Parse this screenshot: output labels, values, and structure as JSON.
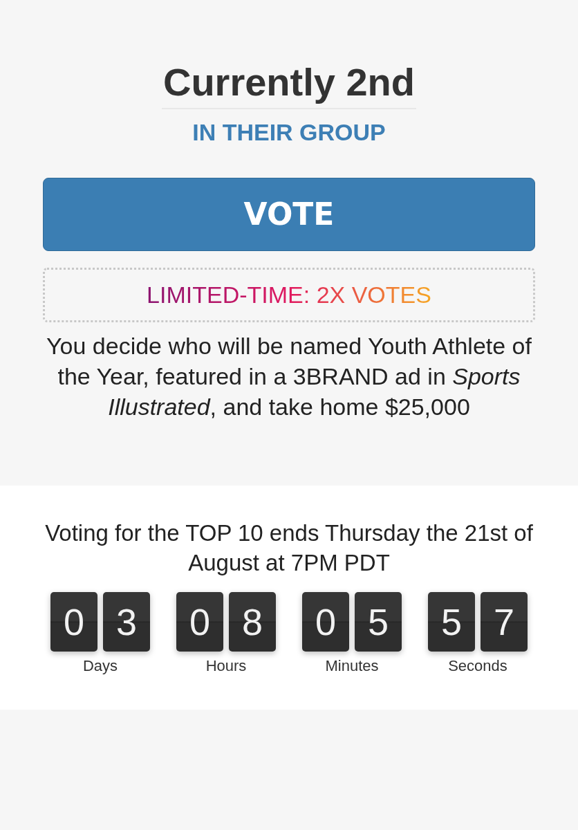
{
  "rank": {
    "title": "Currently 2nd",
    "subtitle": "IN THEIR GROUP"
  },
  "vote_button": {
    "label": "VOTE"
  },
  "promo": {
    "text": "LIMITED-TIME: 2X VOTES"
  },
  "description": "You decide who will be named Youth Athlete of the Year, featured in a 3BRAND ad in *Sports Illustrated*, and take home $25,000",
  "deadline": "Voting for the TOP 10 ends Thursday the 21st of August at 7PM PDT",
  "countdown": [
    {
      "digits": [
        "0",
        "3"
      ],
      "label": "Days"
    },
    {
      "digits": [
        "0",
        "8"
      ],
      "label": "Hours"
    },
    {
      "digits": [
        "0",
        "5"
      ],
      "label": "Minutes"
    },
    {
      "digits": [
        "5",
        "7"
      ],
      "label": "Seconds"
    }
  ]
}
